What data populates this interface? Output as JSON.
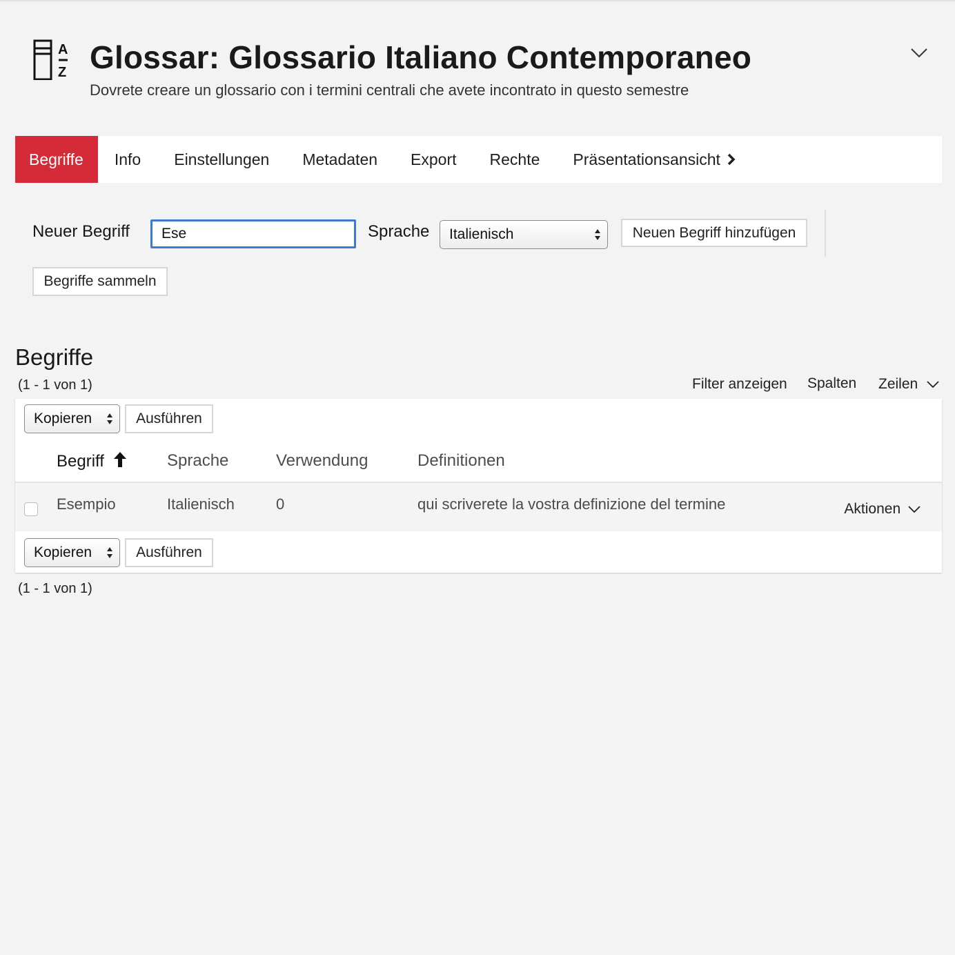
{
  "header": {
    "title": "Glossar: Glossario Italiano Contemporaneo",
    "subtitle": "Dovrete creare un glossario con i termini centrali che avete incontrato in questo semestre",
    "icon": "glossary-az-icon",
    "toggle_icon": "chevron-down-icon"
  },
  "tabs": [
    {
      "label": "Begriffe",
      "active": true
    },
    {
      "label": "Info"
    },
    {
      "label": "Einstellungen"
    },
    {
      "label": "Metadaten"
    },
    {
      "label": "Export"
    },
    {
      "label": "Rechte"
    },
    {
      "label": "Präsentationsansicht",
      "icon": "chevron-right-icon"
    }
  ],
  "form": {
    "new_term_label": "Neuer Begriff",
    "new_term_value": "Ese",
    "language_label": "Sprache",
    "language_value": "Italienisch",
    "add_button": "Neuen Begriff hinzufügen",
    "collect_button": "Begriffe sammeln"
  },
  "table": {
    "title": "Begriffe",
    "count_top": "(1 - 1 von 1)",
    "count_bottom": "(1 - 1 von 1)",
    "controls": {
      "filter": "Filter anzeigen",
      "columns": "Spalten",
      "rows": "Zeilen"
    },
    "bulk_action": "Kopieren",
    "run_button": "Ausführen",
    "columns": [
      "Begriff",
      "Sprache",
      "Verwendung",
      "Definitionen"
    ],
    "sorted_column": "Begriff",
    "sort_direction": "ascending",
    "rows": [
      {
        "term": "Esempio",
        "language": "Italienisch",
        "usage": "0",
        "definition": "qui scriverete la vostra definizione del termine",
        "actions": "Aktionen"
      }
    ]
  },
  "colors": {
    "accent": "#d52a37",
    "focus": "#3d7bd1",
    "background": "#f3f3f3"
  }
}
